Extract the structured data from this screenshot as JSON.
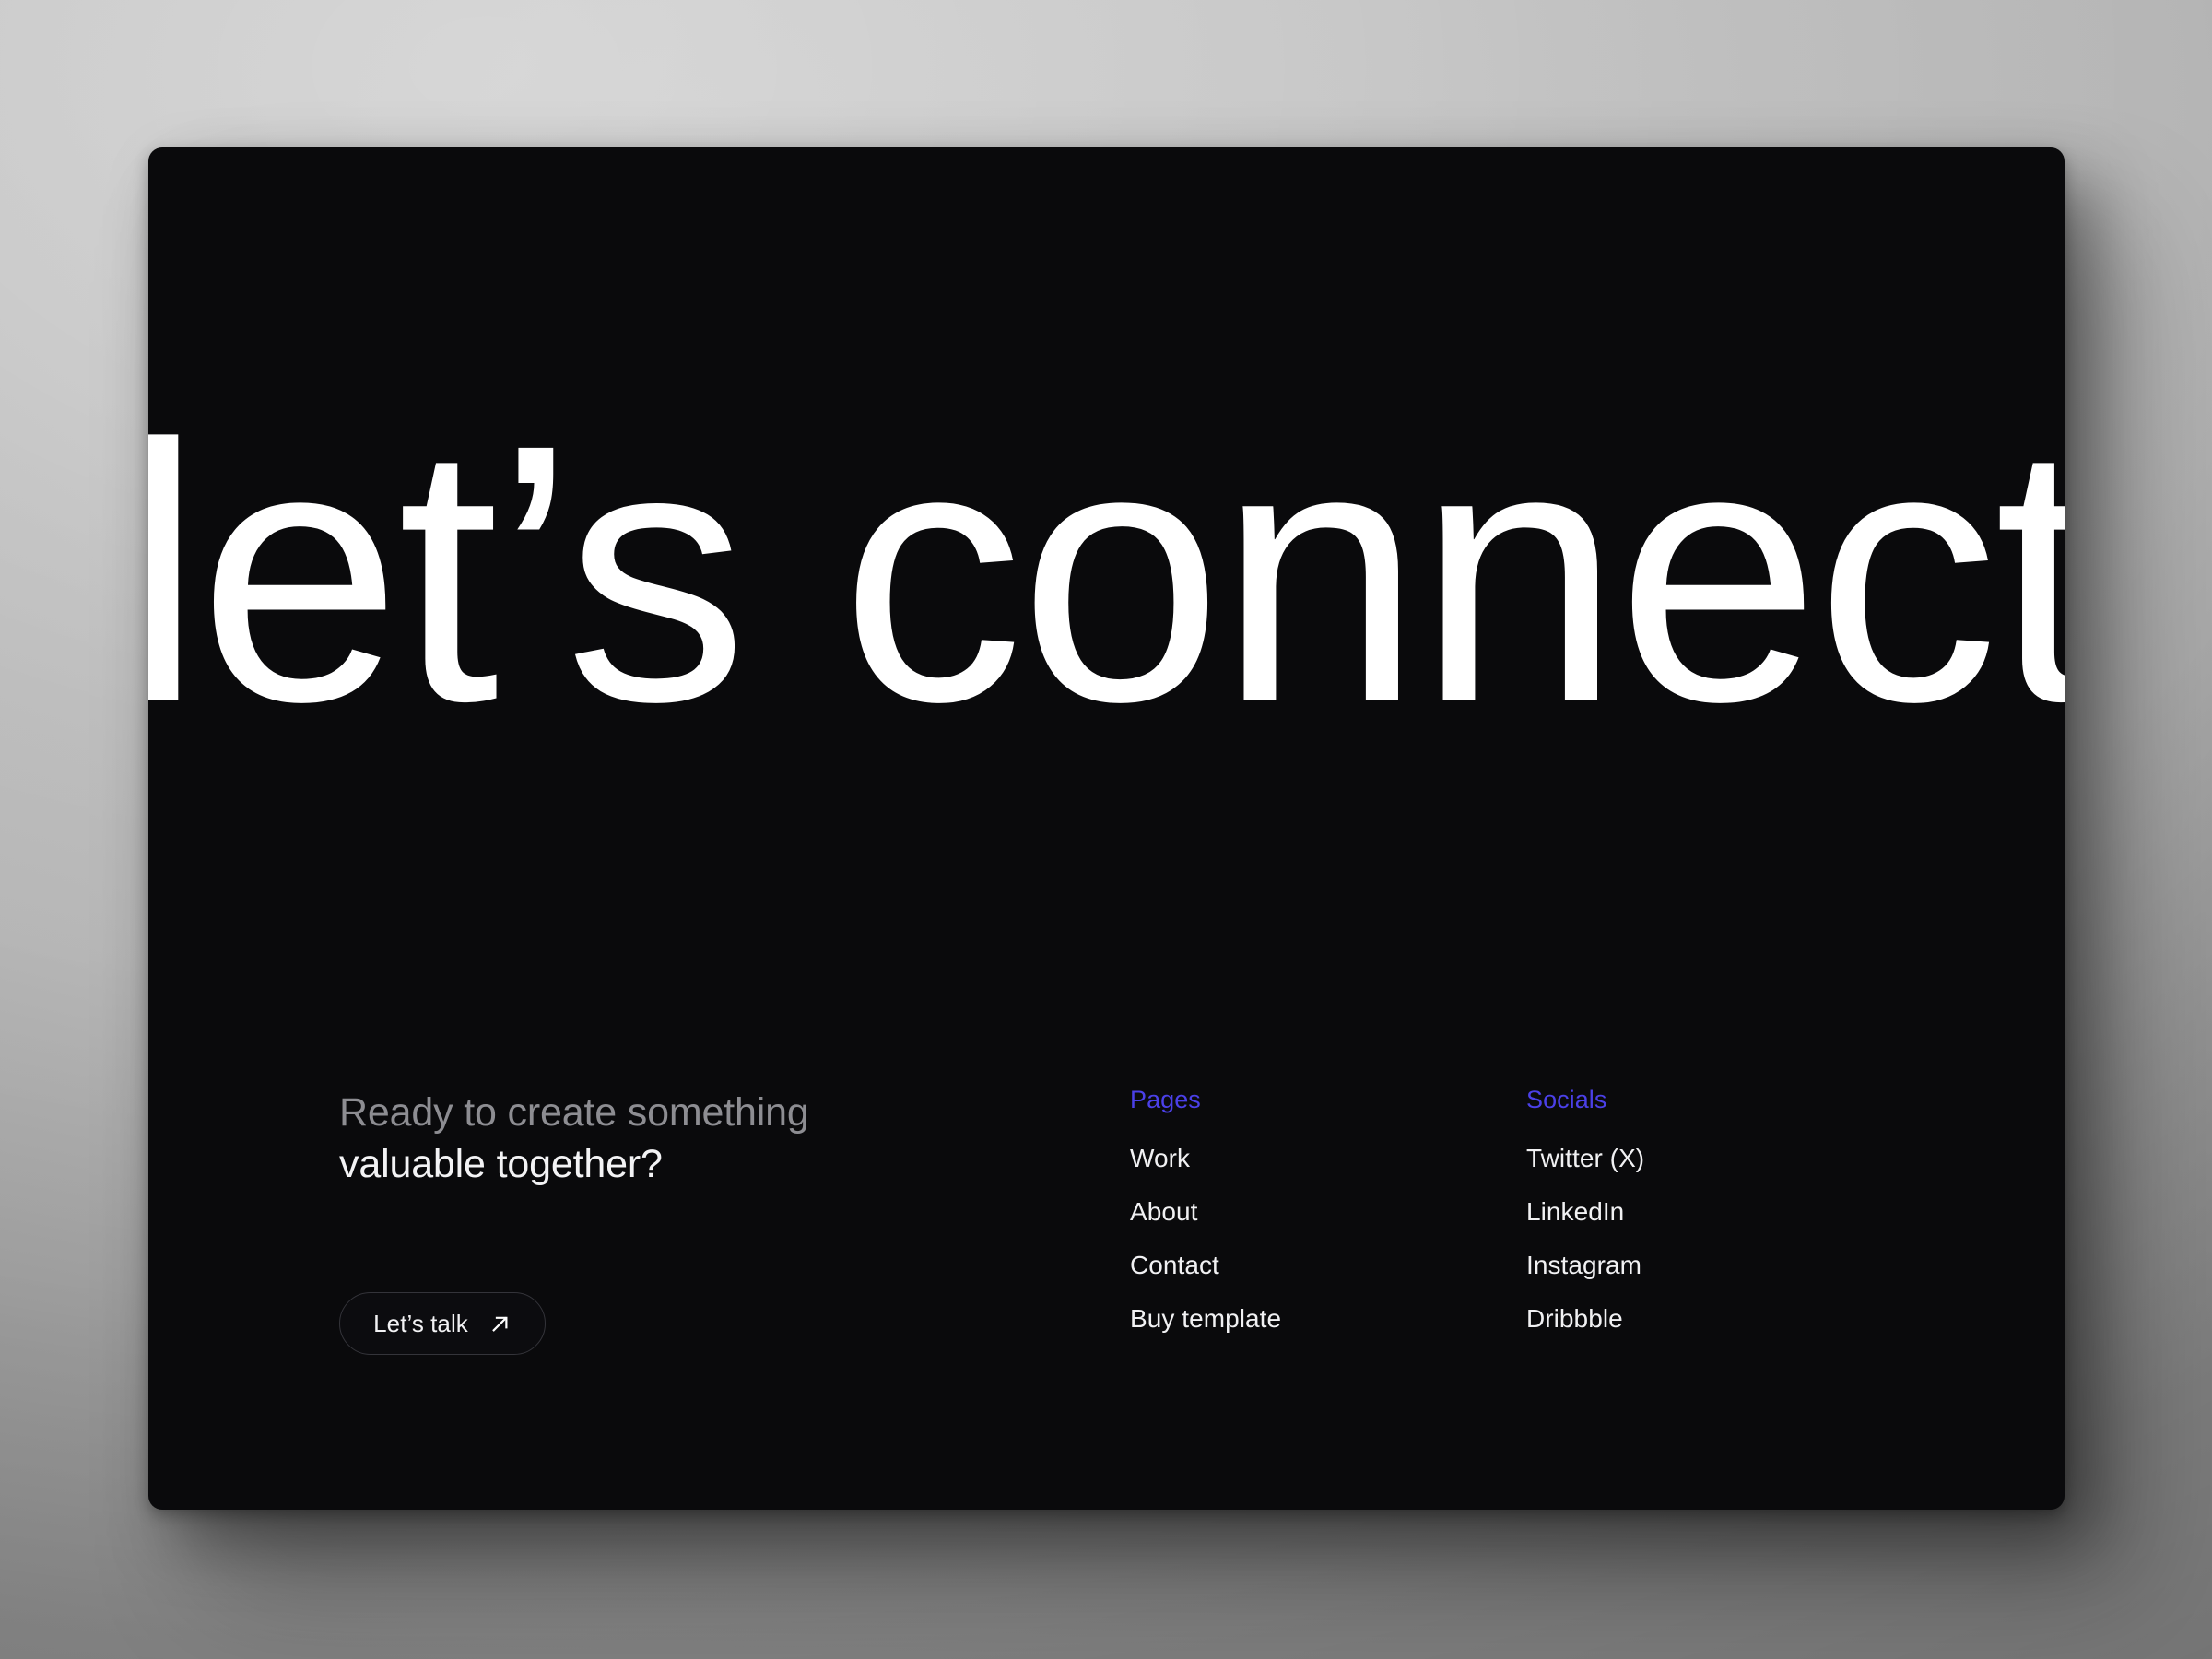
{
  "card": {
    "background_color": "#0a0a0c",
    "accent_color": "#4b40e8"
  },
  "hero": {
    "headline": "let’s connect"
  },
  "tagline": {
    "line1": "Ready to create something",
    "line2": "valuable together?"
  },
  "cta": {
    "label": "Let’s talk",
    "icon": "arrow-up-right-icon"
  },
  "columns": [
    {
      "heading": "Pages",
      "links": [
        "Work",
        "About",
        "Contact",
        "Buy template"
      ]
    },
    {
      "heading": "Socials",
      "links": [
        "Twitter (X)",
        "LinkedIn",
        "Instagram",
        "Dribbble"
      ]
    }
  ]
}
